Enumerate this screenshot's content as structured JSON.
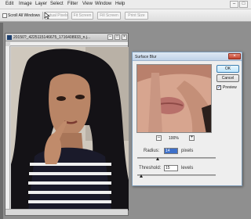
{
  "menu": {
    "items": [
      "Edit",
      "Image",
      "Layer",
      "Select",
      "Filter",
      "View",
      "Window",
      "Help"
    ],
    "win_minimize": "–",
    "win_restore": "□"
  },
  "options": {
    "scroll_all_windows": "Scroll All Windows",
    "buttons": [
      "Actual Pixels",
      "Fit Screen",
      "Fill Screen",
      "Print Size"
    ]
  },
  "document": {
    "title": "20150?_4225115146675_1716408933_n.j...",
    "min": "–",
    "max": "□",
    "close": "×"
  },
  "dialog": {
    "title": "Surface Blur",
    "close": "×",
    "ok": "OK",
    "cancel": "Cancel",
    "preview_label": "Preview",
    "preview_checked": true,
    "zoom_out": "–",
    "zoom_in": "+",
    "zoom": "100%",
    "radius_label": "Radius:",
    "radius_value": "14",
    "radius_unit": "pixels",
    "threshold_label": "Threshold:",
    "threshold_value": "15",
    "threshold_unit": "levels"
  },
  "colors": {
    "dialog_title": "#bfd2e8",
    "close_red": "#c2412b",
    "selection_blue": "#3e70c9"
  }
}
